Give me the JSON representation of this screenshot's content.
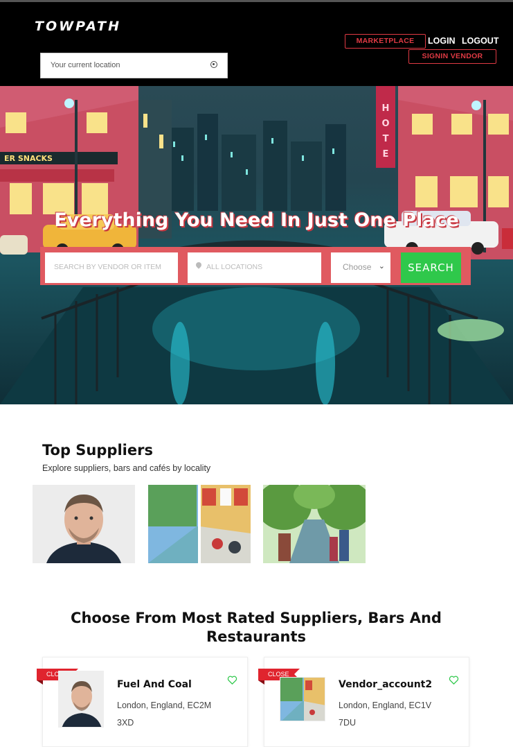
{
  "header": {
    "logo": "TOWPATH",
    "location_placeholder": "Your current location",
    "marketplace_label": "MARKETPLACE",
    "login_label": "LOGIN",
    "logout_label": "LOGOUT",
    "signin_vendor_label": "SIGNIN VENDOR"
  },
  "hero": {
    "title": "Everything You Need In Just One Place",
    "search_placeholder": "SEARCH BY VENDOR OR ITEM",
    "locations_placeholder": "ALL LOCATIONS",
    "choose_label": "Choose",
    "search_button": "SEARCH"
  },
  "top_suppliers": {
    "title": "Top Suppliers",
    "subtitle": "Explore suppliers, bars and cafés by locality"
  },
  "rated": {
    "title": "Choose From Most Rated Suppliers, Bars And Restaurants",
    "cards": [
      {
        "badge": "CLOSE",
        "name": "Fuel And Coal",
        "address": "London, England, EC2M 3XD"
      },
      {
        "badge": "CLOSE",
        "name": "Vendor_account2",
        "address": "London, England, EC1V 7DU"
      }
    ]
  },
  "colors": {
    "accent_red": "#e03a44",
    "search_green": "#2fc84b",
    "header_bg": "#000000"
  },
  "icons": [
    "crosshair-icon",
    "map-pin-icon",
    "chevron-down-icon",
    "heart-icon"
  ]
}
